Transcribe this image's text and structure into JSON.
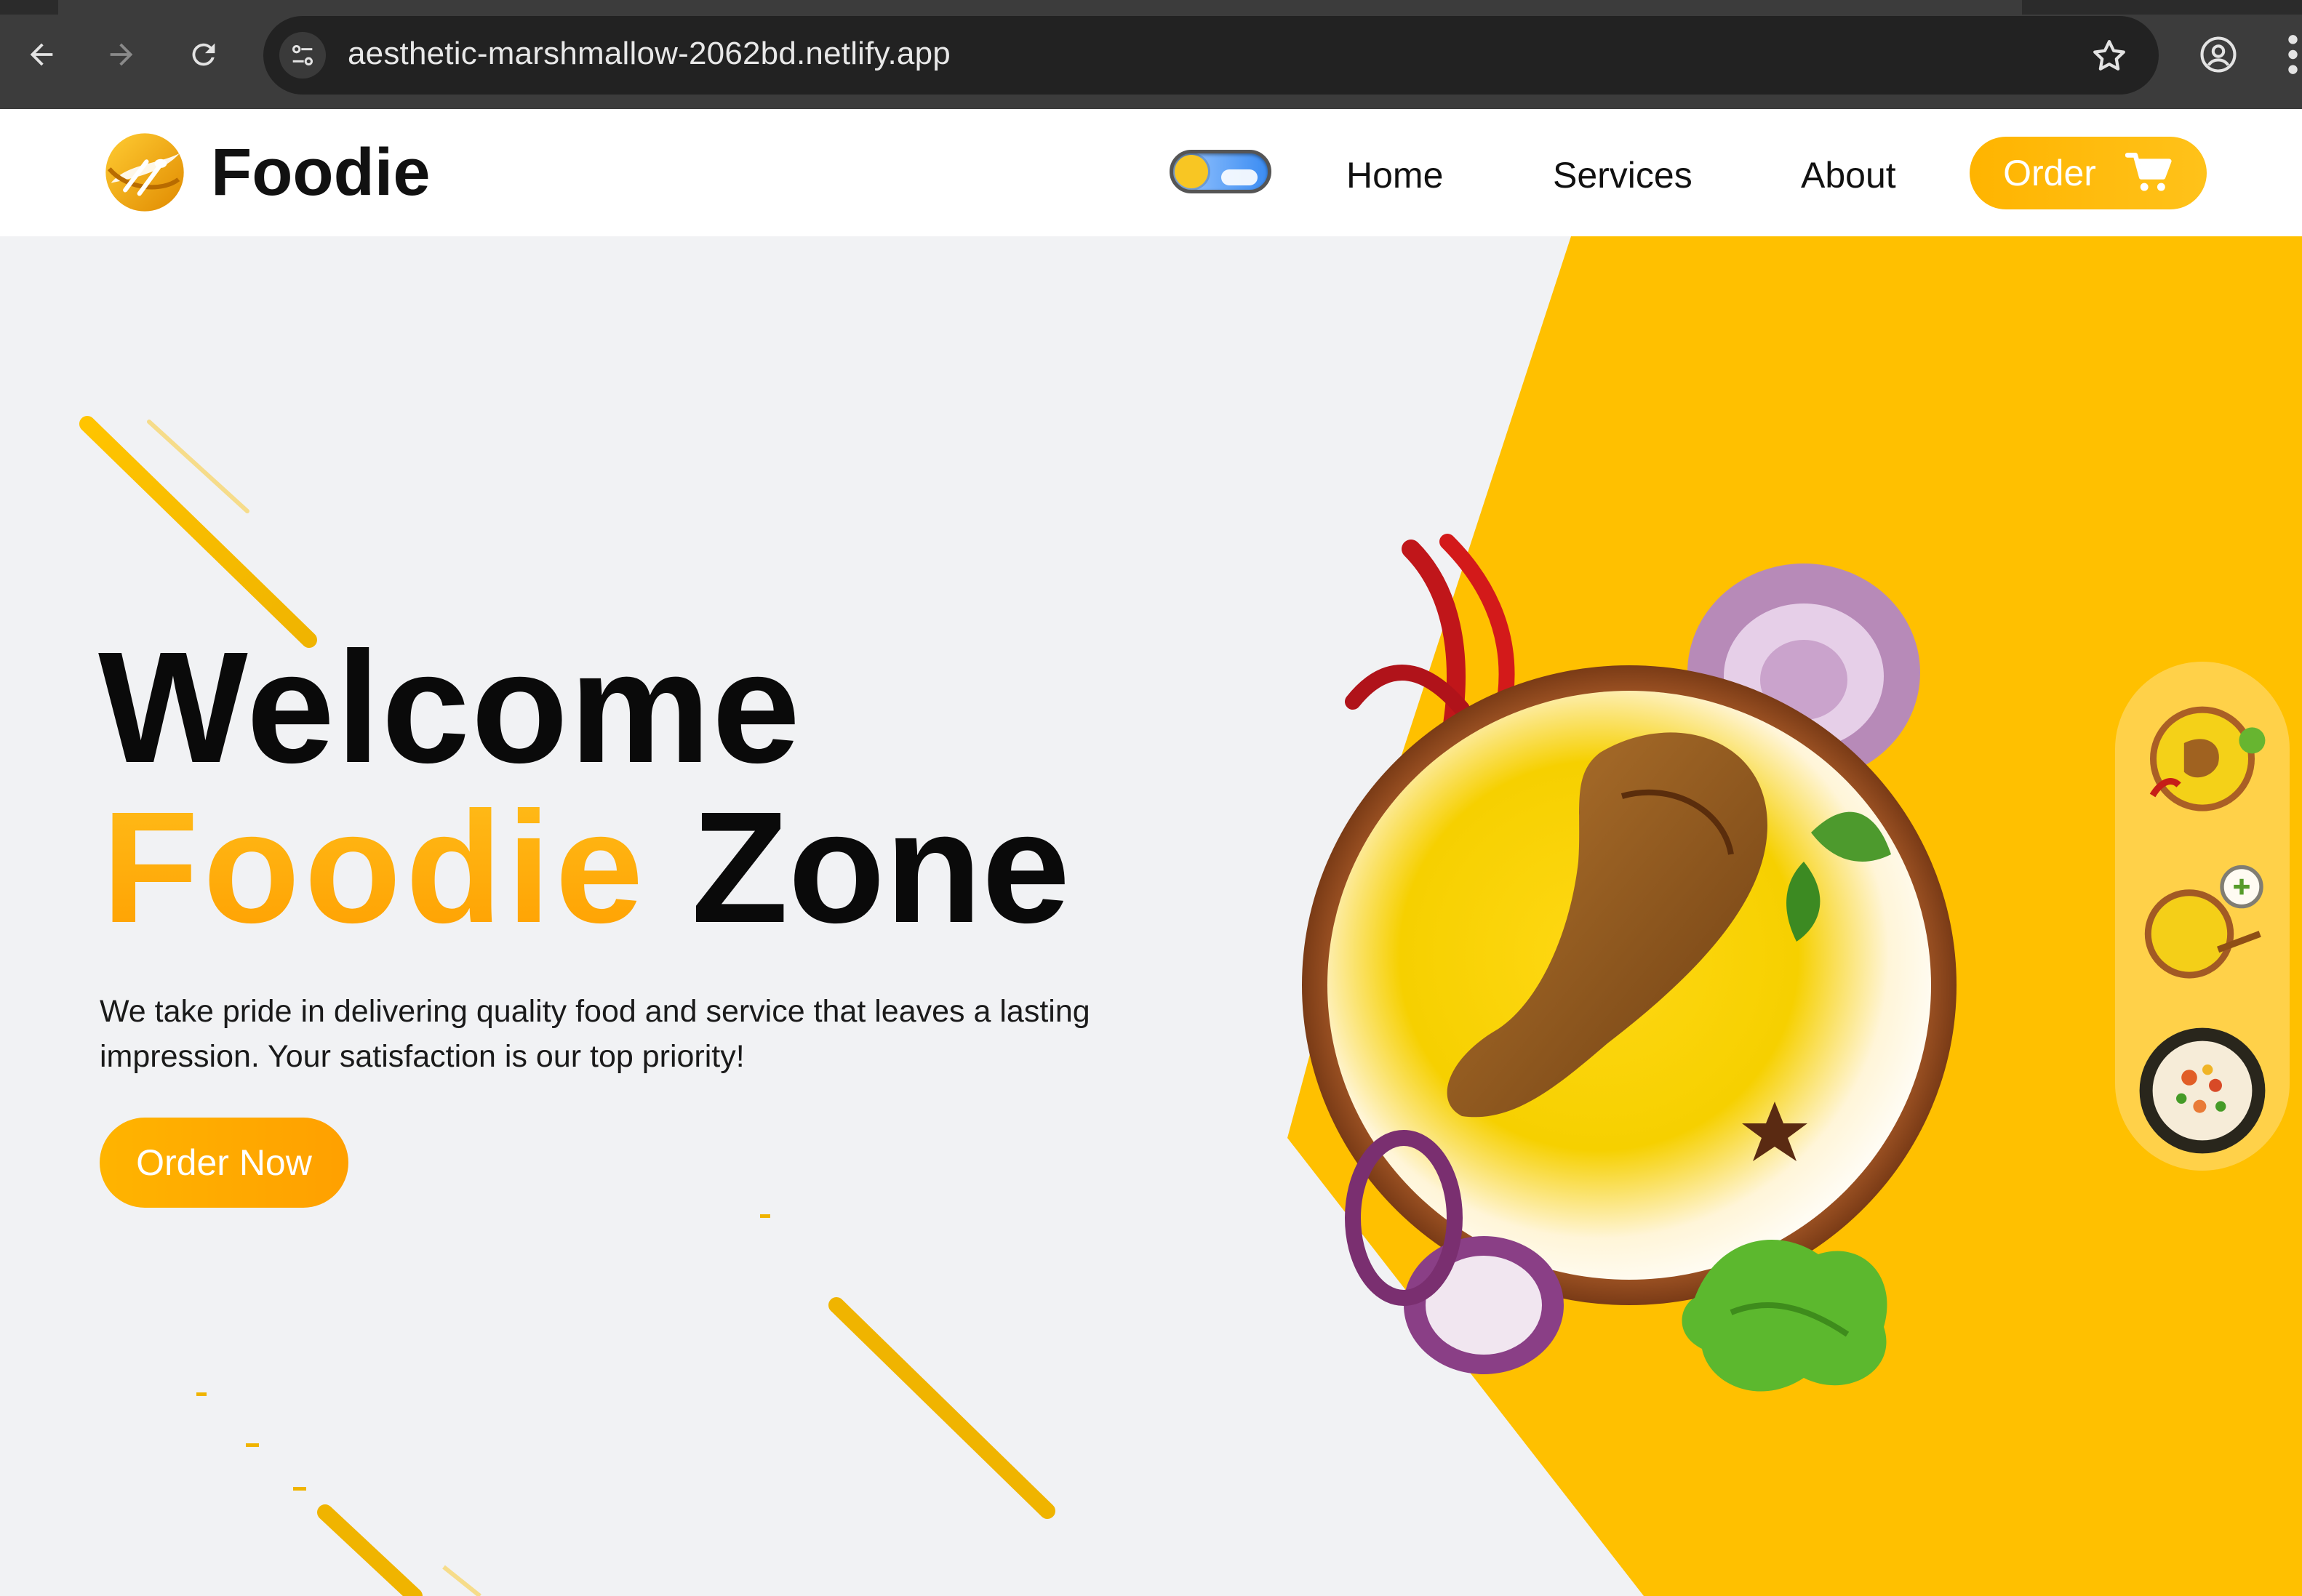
{
  "browser": {
    "url": "aesthetic-marshmallow-2062bd.netlify.app",
    "back_icon": "arrow-left-icon",
    "forward_icon": "arrow-right-icon",
    "reload_icon": "reload-icon",
    "site_info_icon": "tune-icon",
    "bookmark_icon": "star-icon",
    "profile_icon": "account-circle-icon",
    "menu_icon": "kebab-menu-icon"
  },
  "header": {
    "logo_text": "Foodie",
    "logo_icon": "fork-spoon-logo-icon",
    "theme_toggle_icon": "sun-cloud-toggle-icon",
    "nav": [
      "Home",
      "Services",
      "About"
    ],
    "order_label": "Order",
    "order_icon": "cart-icon"
  },
  "hero": {
    "title_line1": "Welcome",
    "title_accent": "Foodie",
    "title_rest": "Zone",
    "tagline": "We take pride in delivering quality food and service that leaves a lasting impression. Your satisfaction is our top priority!",
    "cta_label": "Order Now",
    "main_image": "biryani-plate-image",
    "thumbnails": [
      "biryani-plate-thumbnail",
      "biryani-raita-thumbnail",
      "vegetable-rice-thumbnail"
    ]
  },
  "colors": {
    "accent_yellow": "#ffbe00",
    "accent_orange": "#ffa000",
    "background": "#f1f2f4",
    "text_dark": "#0a0a0a"
  }
}
